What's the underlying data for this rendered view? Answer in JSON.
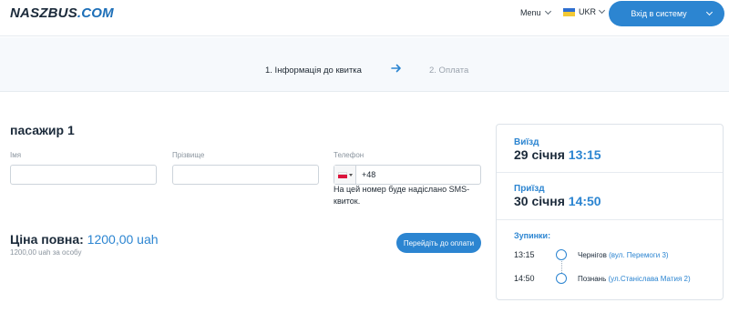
{
  "header": {
    "logo_main": "NASZBUS",
    "logo_suffix": ".COM",
    "menu_label": "Menu",
    "language": "UKR",
    "login_label": "Вхід в систему"
  },
  "steps": {
    "step1": "1. Інформація до квитка",
    "step2": "2. Оплата"
  },
  "passenger": {
    "title": "пасажир 1",
    "first_name_label": "Імя",
    "first_name_value": "",
    "last_name_label": "Прізвище",
    "last_name_value": "",
    "phone_label": "Телефон",
    "phone_code": "+48",
    "sms_note": "На цей номер буде надіслано SMS-квиток."
  },
  "price": {
    "label": "Ціна повна:",
    "amount": "1200,00 uah",
    "per_person": "1200,00 uah за особу",
    "pay_button": "Перейдіть до оплати"
  },
  "trip": {
    "departure_label": "Виїзд",
    "departure_date": "29 січня",
    "departure_time": "13:15",
    "arrival_label": "Приїзд",
    "arrival_date": "30 січня",
    "arrival_time": "14:50",
    "stops_label": "Зупинки:",
    "stops": [
      {
        "time": "13:15",
        "city": "Чернігов",
        "address": "(вул. Перемоги 3)"
      },
      {
        "time": "14:50",
        "city": "Познань",
        "address": "(ул.Станіслава Матия 2)"
      }
    ]
  },
  "colors": {
    "accent": "#2c85d1",
    "text_dark": "#1b2a3a",
    "muted": "#8a949e"
  }
}
